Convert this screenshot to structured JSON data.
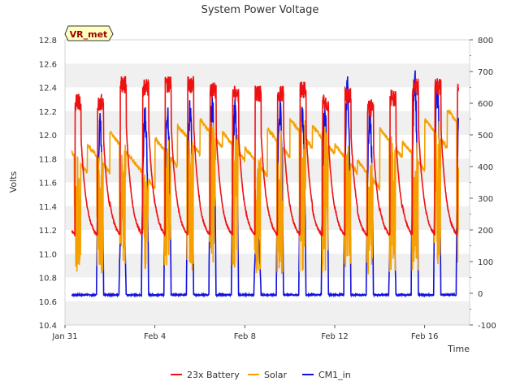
{
  "chart_data": {
    "type": "line",
    "title": "System Power Voltage",
    "xlabel": "Time",
    "ylabel": "Volts",
    "site_label": "VR_met",
    "x_range": [
      "2017-01-31",
      "2017-02-18"
    ],
    "x_ticks": [
      {
        "label": "Jan 31",
        "day": 0
      },
      {
        "label": "Feb 4",
        "day": 4
      },
      {
        "label": "Feb 8",
        "day": 8
      },
      {
        "label": "Feb 12",
        "day": 12
      },
      {
        "label": "Feb 16",
        "day": 16
      }
    ],
    "ylim": [
      10.4,
      12.8
    ],
    "y_ticks": [
      10.4,
      10.6,
      10.8,
      11.0,
      11.2,
      11.4,
      11.6,
      11.8,
      12.0,
      12.2,
      12.4,
      12.6,
      12.8
    ],
    "y2lim": [
      -100,
      800
    ],
    "y2_ticks": [
      -100,
      0,
      100,
      200,
      300,
      400,
      500,
      600,
      700,
      800
    ],
    "grid": "horizontal bands",
    "legend_placement": "bottom-center",
    "series": [
      {
        "name": "23x Battery",
        "color": "#ee1111",
        "axis": "left",
        "width": 1.6,
        "day0": 0.3,
        "day1": 17.5,
        "base": 11.06,
        "peak": 12.38,
        "decay": 0.8,
        "peaks": [
          12.35,
          12.5,
          12.47,
          12.5,
          12.5,
          12.45,
          12.42,
          12.42,
          12.43,
          12.45,
          12.35,
          12.41,
          12.3,
          12.38,
          12.48,
          12.48,
          12.45
        ]
      },
      {
        "name": "Solar",
        "color": "#f5a000",
        "axis": "right",
        "width": 1.6,
        "day0": 0.3,
        "day1": 17.5,
        "levels": [
          470,
          510,
          420,
          490,
          530,
          550,
          510,
          460,
          520,
          550,
          530,
          470,
          420,
          520,
          480,
          550,
          580
        ]
      },
      {
        "name": "CM1_in",
        "color": "#1111dd",
        "axis": "right",
        "width": 1.6,
        "day0": 0.3,
        "day1": 17.5,
        "base": -5,
        "peaks": [
          580,
          300,
          620,
          630,
          630,
          640,
          630,
          210,
          630,
          630,
          620,
          700,
          620,
          290,
          740,
          700,
          700
        ]
      }
    ]
  }
}
